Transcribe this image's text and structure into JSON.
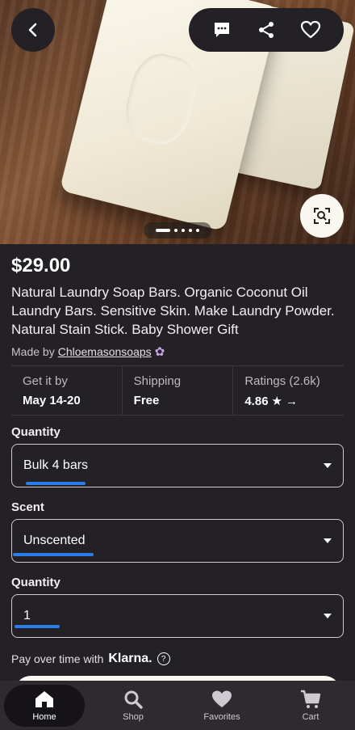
{
  "price": "$29.00",
  "title": "Natural Laundry Soap Bars.  Organic Coconut Oil Laundry Bars.  Sensitive Skin.  Make Laundry Powder.  Natural Stain Stick.  Baby Shower Gift",
  "maker": {
    "prefix": "Made by",
    "shop": "Chloemasonsoaps"
  },
  "info": {
    "delivery": {
      "label": "Get it by",
      "value": "May 14-20"
    },
    "shipping": {
      "label": "Shipping",
      "value": "Free"
    },
    "ratings": {
      "label": "Ratings (2.6k)",
      "value": "4.86"
    }
  },
  "options": [
    {
      "label": "Quantity",
      "value": "Bulk 4 bars"
    },
    {
      "label": "Scent",
      "value": "Unscented"
    },
    {
      "label": "Quantity",
      "value": "1"
    }
  ],
  "klarna": {
    "text": "Pay over time with",
    "brand": "Klarna.",
    "help": "?"
  },
  "carousel": {
    "total": 5,
    "current": 1
  },
  "nav": [
    {
      "label": "Home",
      "icon": "home-icon"
    },
    {
      "label": "Shop",
      "icon": "search-icon"
    },
    {
      "label": "Favorites",
      "icon": "heart-icon"
    },
    {
      "label": "Cart",
      "icon": "cart-icon"
    }
  ],
  "colors": {
    "background": "#232126",
    "highlight": "#2b7de9"
  }
}
